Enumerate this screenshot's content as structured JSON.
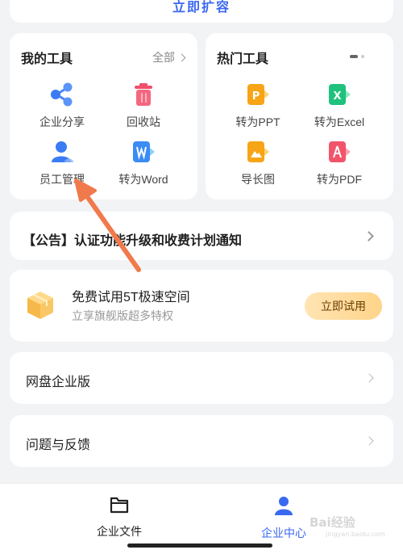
{
  "top_card": {
    "label": "立即扩容"
  },
  "my_tools": {
    "title": "我的工具",
    "all_label": "全部",
    "items": [
      {
        "label": "企业分享",
        "icon": "share-icon"
      },
      {
        "label": "回收站",
        "icon": "trash-icon"
      },
      {
        "label": "员工管理",
        "icon": "user-icon"
      },
      {
        "label": "转为Word",
        "icon": "word-icon"
      }
    ]
  },
  "hot_tools": {
    "title": "热门工具",
    "items": [
      {
        "label": "转为PPT",
        "icon": "ppt-icon",
        "glyph": "P"
      },
      {
        "label": "转为Excel",
        "icon": "excel-icon",
        "glyph": "X"
      },
      {
        "label": "导长图",
        "icon": "long-image-icon"
      },
      {
        "label": "转为PDF",
        "icon": "pdf-icon"
      }
    ]
  },
  "notice": {
    "text": "【公告】认证功能升级和收费计划通知"
  },
  "trial": {
    "title": "免费试用5T极速空间",
    "subtitle": "立享旗舰版超多特权",
    "button": "立即试用"
  },
  "menu": [
    {
      "label": "网盘企业版"
    },
    {
      "label": "问题与反馈"
    }
  ],
  "tabbar": {
    "tabs": [
      {
        "label": "企业文件",
        "icon": "folder-icon"
      },
      {
        "label": "企业中心",
        "icon": "person-icon"
      }
    ]
  },
  "watermark": {
    "text": "Bai经验",
    "sub": "jingyan.baidu.com"
  },
  "colors": {
    "accent": "#3a68f0",
    "annotation_arrow": "#f07a4c",
    "trial_button": "#ffd48a"
  }
}
